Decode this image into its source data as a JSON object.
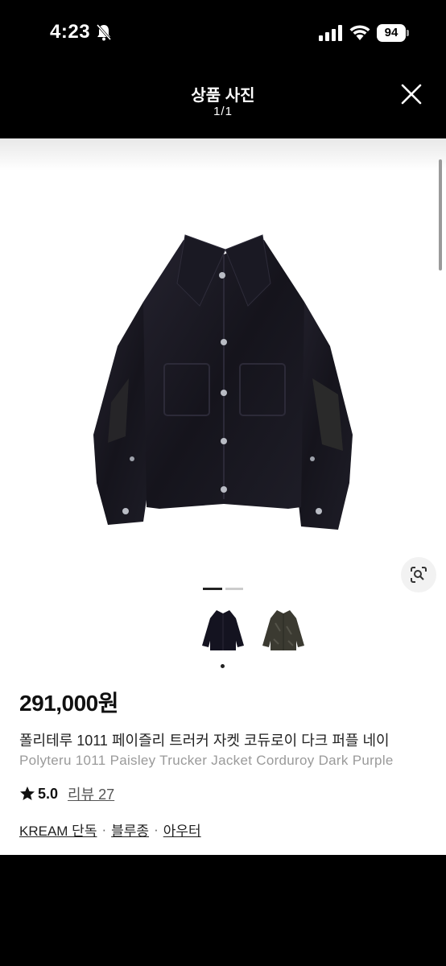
{
  "status_bar": {
    "time": "4:23",
    "battery": "94",
    "icons": [
      "bell-slash-icon",
      "signal-icon",
      "wifi-icon",
      "battery-icon"
    ]
  },
  "header": {
    "title": "상품 사진",
    "counter": "1/1",
    "close_icon": "close-icon"
  },
  "product": {
    "price": "291,000원",
    "name_ko": "폴리테루 1011 페이즐리 트러커 자켓 코듀로이 다크 퍼플 네이",
    "name_en": "Polyteru 1011 Paisley Trucker Jacket Corduroy Dark Purple",
    "rating": "5.0",
    "review_label": "리뷰 27",
    "tags": [
      "KREAM 단독",
      "블루종",
      "아우터"
    ],
    "tag_separator": "·"
  },
  "gallery": {
    "thumbnails": [
      "jacket-dark-thumbnail",
      "jacket-olive-thumbnail"
    ],
    "lens_icon": "lens-search-icon"
  },
  "colors": {
    "background": "#000000",
    "content": "#ffffff",
    "jacket": "#1b1a24"
  }
}
